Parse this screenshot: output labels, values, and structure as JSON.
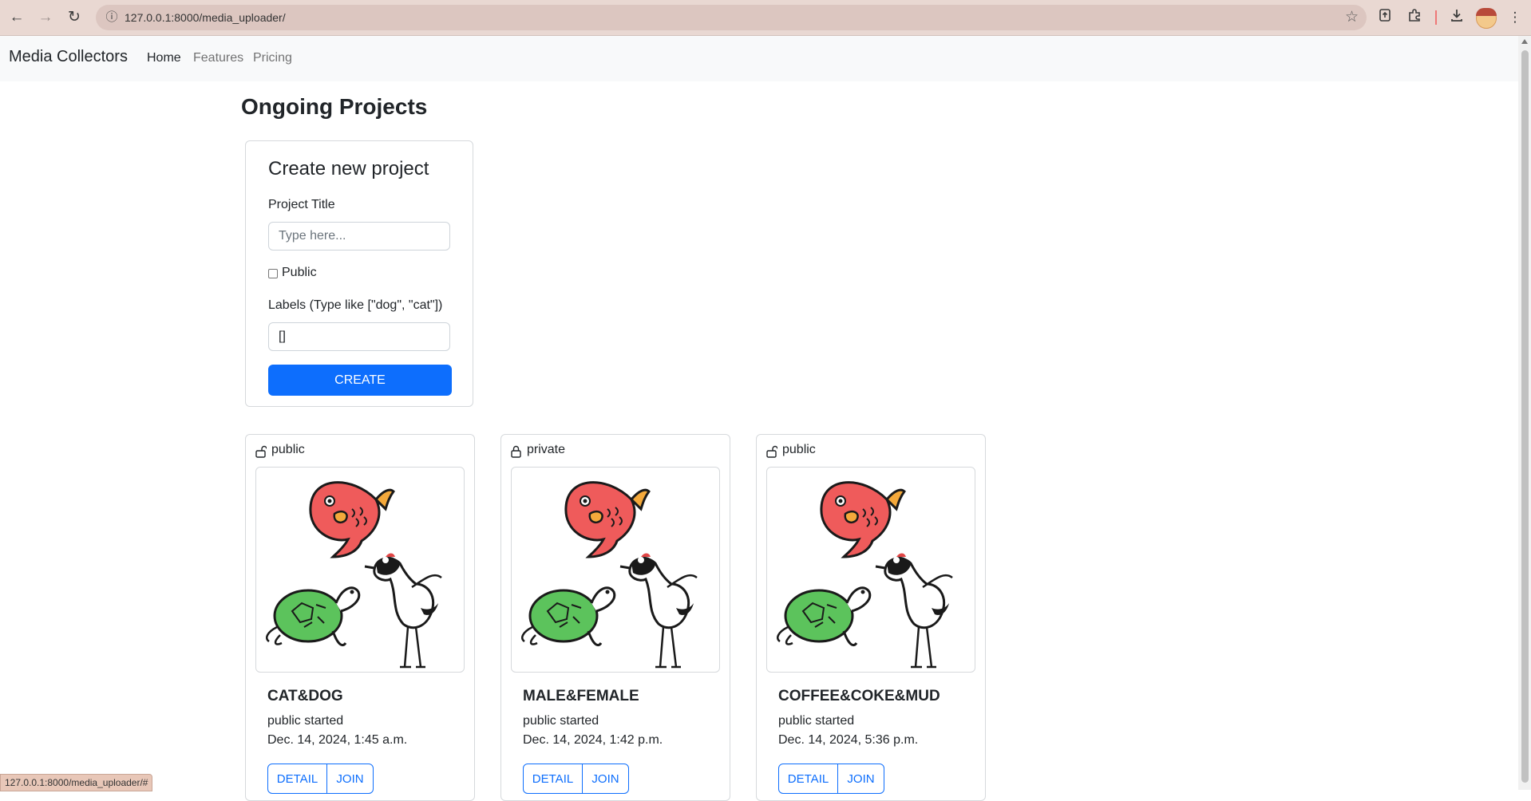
{
  "browser": {
    "url": "127.0.0.1:8000/media_uploader/",
    "status_url": "127.0.0.1:8000/media_uploader/#"
  },
  "navbar": {
    "brand": "Media Collectors",
    "links": [
      "Home",
      "Features",
      "Pricing"
    ]
  },
  "page": {
    "title": "Ongoing Projects"
  },
  "form": {
    "heading": "Create new project",
    "title_label": "Project Title",
    "title_placeholder": "Type here...",
    "public_label": "Public",
    "labels_label": "Labels (Type like [\"dog\", \"cat\"])",
    "labels_value": "[]",
    "create_button": "CREATE"
  },
  "projects": [
    {
      "visibility": "public",
      "title": "CAT&DOG",
      "status": "public started",
      "date": "Dec. 14, 2024, 1:45 a.m.",
      "detail": "DETAIL",
      "join": "JOIN"
    },
    {
      "visibility": "private",
      "title": "MALE&FEMALE",
      "status": "public started",
      "date": "Dec. 14, 2024, 1:42 p.m.",
      "detail": "DETAIL",
      "join": "JOIN"
    },
    {
      "visibility": "public",
      "title": "COFFEE&COKE&MUD",
      "status": "public started",
      "date": "Dec. 14, 2024, 5:36 p.m.",
      "detail": "DETAIL",
      "join": "JOIN"
    }
  ],
  "colors": {
    "primary": "#0d6efd",
    "chrome": "#e9d8d2",
    "navbar_bg": "#f8f9fa"
  }
}
